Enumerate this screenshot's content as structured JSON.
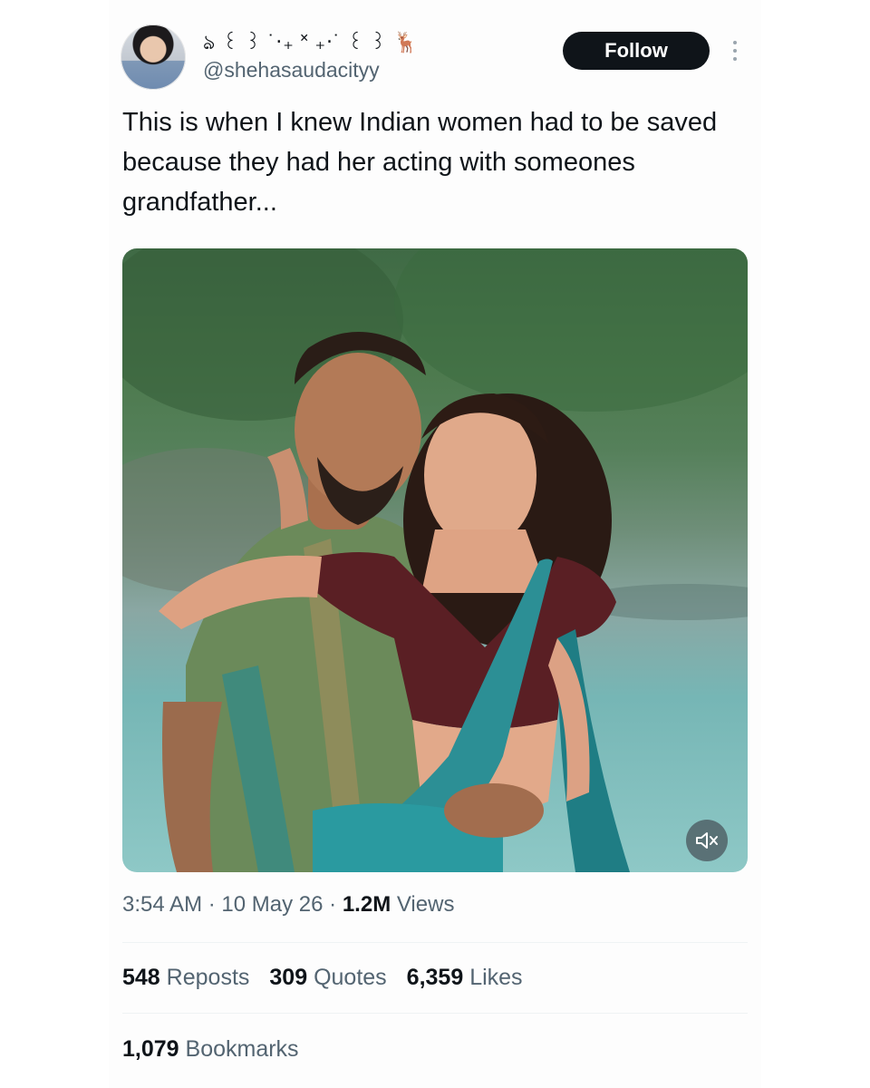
{
  "user": {
    "display_name": "ঌ ꒰ ꒱ ˙‧₊ ˟ ₊‧˙ ꒰ ꒱ 🦌",
    "handle": "@shehasaudacityy",
    "follow_label": "Follow"
  },
  "tweet": {
    "text": "This is when I knew Indian women had to be saved because they had her acting with someones grandfather...",
    "time": "3:54 AM",
    "date": "10 May 26",
    "views_count": "1.2M",
    "views_label": "Views"
  },
  "stats": {
    "reposts_count": "548",
    "reposts_label": "Reposts",
    "quotes_count": "309",
    "quotes_label": "Quotes",
    "likes_count": "6,359",
    "likes_label": "Likes",
    "bookmarks_count": "1,079",
    "bookmarks_label": "Bookmarks"
  },
  "colors": {
    "text_primary": "#0f1419",
    "text_secondary": "#536471",
    "button_bg": "#0f1419"
  },
  "icons": {
    "more": "more-options-icon",
    "mute": "speaker-muted-icon"
  }
}
